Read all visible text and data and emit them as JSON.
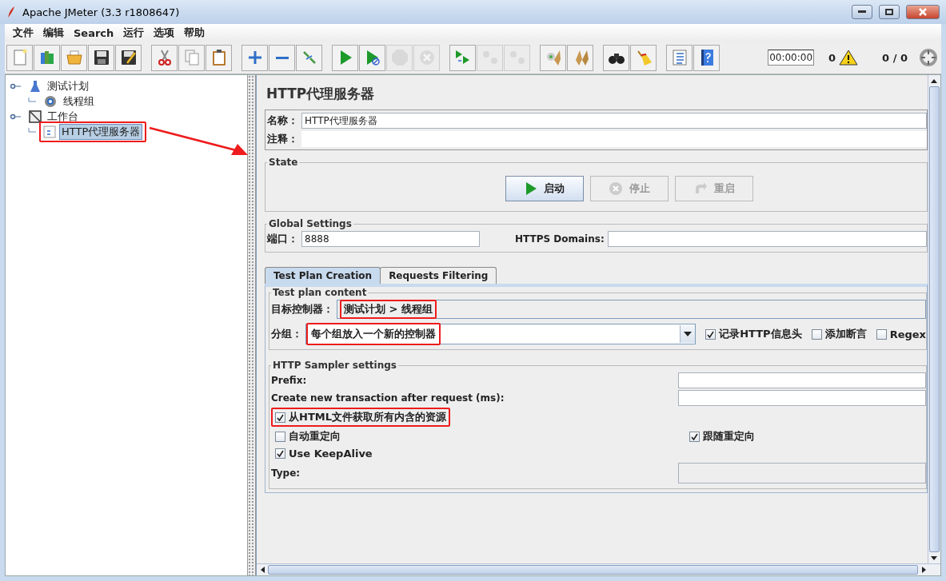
{
  "window": {
    "title": "Apache JMeter (3.3 r1808647)"
  },
  "menu": [
    "文件",
    "编辑",
    "Search",
    "运行",
    "选项",
    "帮助"
  ],
  "toolbar": [
    {
      "buttons": [
        {
          "kind": "new",
          "disabled": false
        },
        {
          "kind": "templates",
          "disabled": false
        },
        {
          "kind": "open",
          "disabled": false
        },
        {
          "kind": "save",
          "disabled": false
        },
        {
          "kind": "save-as",
          "disabled": false
        }
      ]
    },
    {
      "buttons": [
        {
          "kind": "cut",
          "disabled": false
        },
        {
          "kind": "copy",
          "disabled": false
        },
        {
          "kind": "paste",
          "disabled": false
        }
      ]
    },
    {
      "buttons": [
        {
          "kind": "expand",
          "disabled": false
        },
        {
          "kind": "collapse",
          "disabled": false
        },
        {
          "kind": "toggle",
          "disabled": false
        }
      ]
    },
    {
      "buttons": [
        {
          "kind": "start",
          "disabled": false
        },
        {
          "kind": "start-no-pause",
          "disabled": false
        },
        {
          "kind": "stop",
          "disabled": true
        },
        {
          "kind": "shutdown",
          "disabled": true
        }
      ]
    },
    {
      "buttons": [
        {
          "kind": "remote-start",
          "disabled": false
        },
        {
          "kind": "remote-stop",
          "disabled": true
        },
        {
          "kind": "remote-shutdown",
          "disabled": true
        }
      ]
    },
    {
      "buttons": [
        {
          "kind": "clear",
          "disabled": false
        },
        {
          "kind": "clear-all",
          "disabled": false
        }
      ]
    },
    {
      "buttons": [
        {
          "kind": "search",
          "disabled": false
        },
        {
          "kind": "reset-search",
          "disabled": false
        }
      ]
    },
    {
      "buttons": [
        {
          "kind": "function-helper",
          "disabled": false
        },
        {
          "kind": "help",
          "disabled": false
        }
      ]
    }
  ],
  "status": {
    "timer": "00:00:00",
    "warnings": "0",
    "threads": "0 / 0"
  },
  "tree": [
    {
      "label": "测试计划",
      "kind": "plan",
      "selected": false,
      "highlighted": false,
      "children": [
        {
          "label": "线程组",
          "kind": "threads",
          "selected": false,
          "highlighted": false
        }
      ]
    },
    {
      "label": "工作台",
      "kind": "workbench",
      "selected": false,
      "highlighted": false,
      "children": [
        {
          "label": "HTTP代理服务器",
          "kind": "proxy",
          "selected": true,
          "highlighted": true
        }
      ]
    }
  ],
  "panel": {
    "title": "HTTP代理服务器",
    "name": {
      "label": "名称：",
      "value": "HTTP代理服务器"
    },
    "comment": {
      "label": "注释："
    },
    "state": {
      "title": "State",
      "buttons": [
        {
          "label": "启动",
          "kind": "start",
          "disabled": false
        },
        {
          "label": "停止",
          "kind": "stop",
          "disabled": true
        },
        {
          "label": "重启",
          "kind": "restart",
          "disabled": true
        }
      ]
    },
    "global": {
      "title": "Global Settings",
      "port": {
        "label": "端口：",
        "value": "8888"
      },
      "https": {
        "label": "HTTPS Domains:"
      }
    },
    "tabs": [
      {
        "label": "Test Plan Creation",
        "selected": true
      },
      {
        "label": "Requests Filtering",
        "selected": false
      }
    ],
    "plan_content": {
      "title": "Test plan content",
      "target": {
        "label": "目标控制器：",
        "value": "测试计划 > 线程组",
        "highlighted": true
      },
      "grouping": {
        "label": "分组：",
        "value": "每个组放入一个新的控制器",
        "highlighted": true
      },
      "options": [
        {
          "label": "记录HTTP信息头",
          "checked": true
        },
        {
          "label": "添加断言",
          "checked": false
        },
        {
          "label": "Regex",
          "checked": false
        }
      ]
    },
    "sampler": {
      "title": "HTTP Sampler settings",
      "prefix": {
        "label": "Prefix:"
      },
      "transaction": {
        "label": "Create new transaction after request (ms):"
      },
      "retrieve": {
        "label": "从HTML文件获取所有内含的资源",
        "checked": true,
        "highlighted": true
      },
      "redirect_auto": {
        "label": "自动重定向",
        "checked": false
      },
      "redirect_follow": {
        "label": "跟随重定向",
        "checked": true
      },
      "keepalive": {
        "label": "Use KeepAlive",
        "checked": true
      },
      "type": {
        "label": "Type:"
      }
    }
  }
}
